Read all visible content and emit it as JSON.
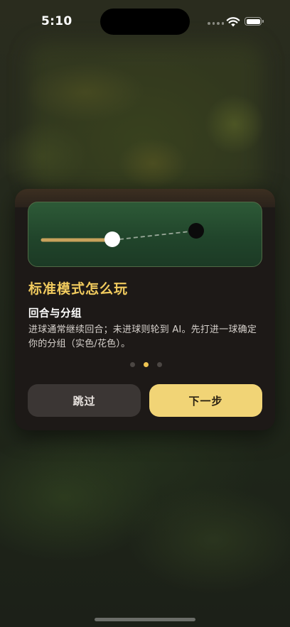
{
  "status_bar": {
    "time": "5:10",
    "icons": [
      "cellular-signal-icon",
      "wifi-icon",
      "battery-icon"
    ]
  },
  "tutorial": {
    "illustration": "pool-table-cue-aim-illustration",
    "title": "标准模式怎么玩",
    "subtitle": "回合与分组",
    "body": "进球通常继续回合；未进球则轮到 AI。先打进一球确定你的分组（实色/花色）。",
    "page_indicator": {
      "total": 3,
      "current": 2
    },
    "skip_label": "跳过",
    "next_label": "下一步"
  },
  "colors": {
    "title_accent": "#f1cb5e",
    "next_button": "#f1d476",
    "skip_button": "#3b3634",
    "card_background": "#1d1917",
    "table_felt": "#2d5a37"
  }
}
